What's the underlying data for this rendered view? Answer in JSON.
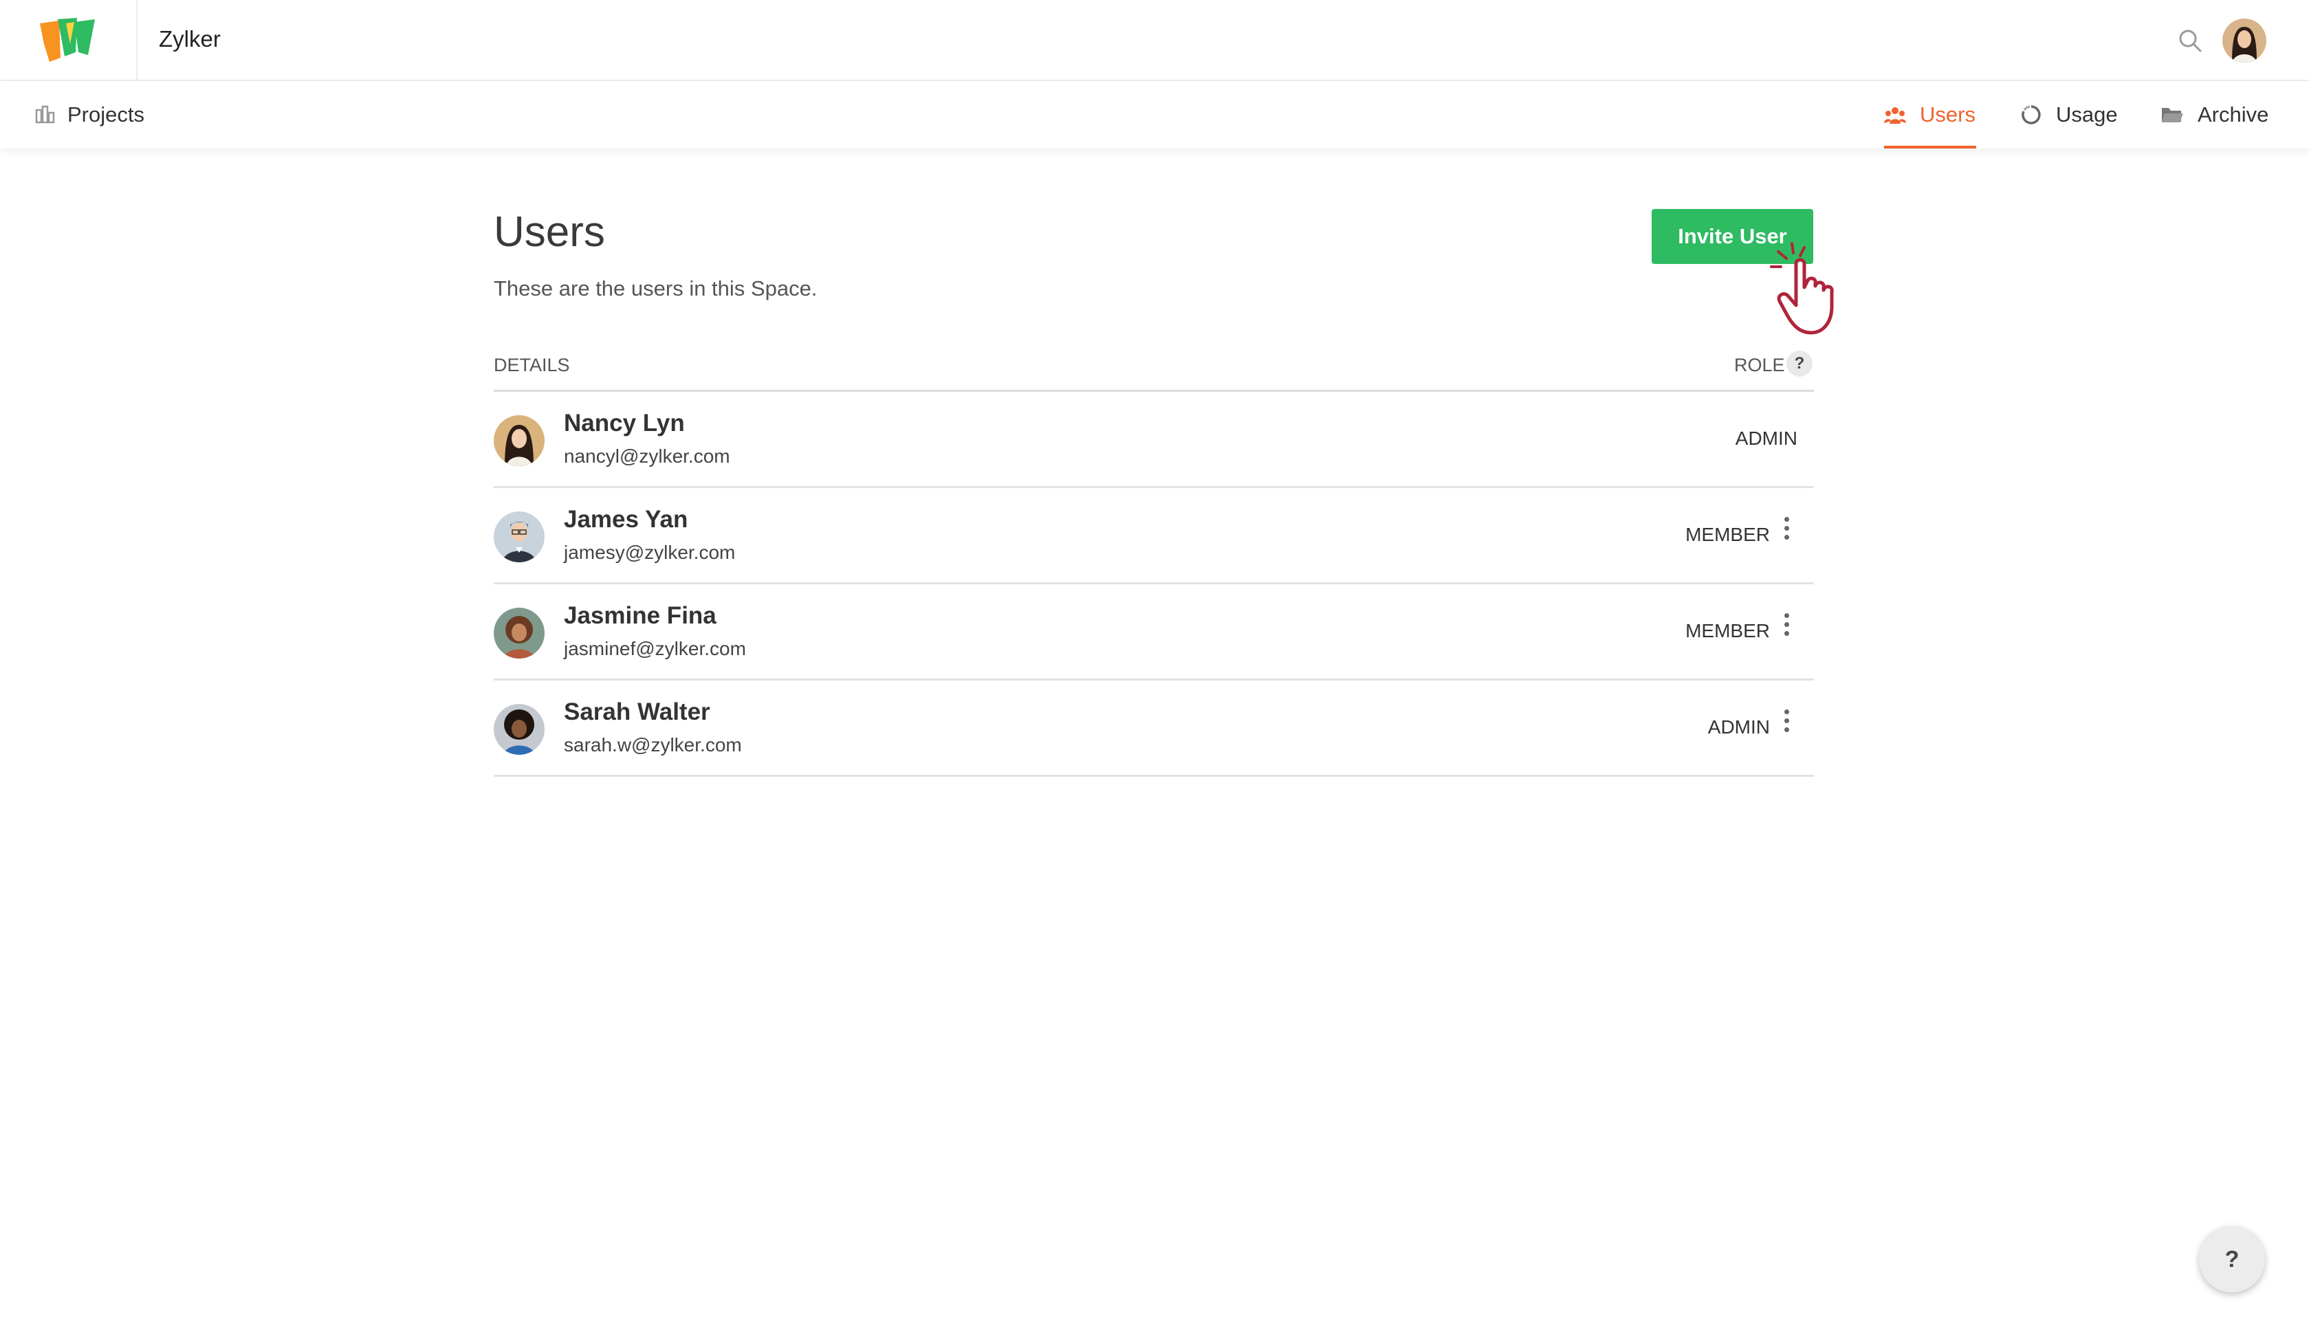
{
  "header": {
    "org_name": "Zylker"
  },
  "nav": {
    "projects_label": "Projects",
    "tabs": [
      {
        "label": "Users",
        "active": true
      },
      {
        "label": "Usage",
        "active": false
      },
      {
        "label": "Archive",
        "active": false
      }
    ]
  },
  "page": {
    "title": "Users",
    "description": "These are the users in this Space.",
    "invite_label": "Invite User"
  },
  "table": {
    "col_details": "DETAILS",
    "col_role": "ROLE",
    "role_help": "?",
    "users": [
      {
        "name": "Nancy Lyn",
        "email": "nancyl@zylker.com",
        "role": "ADMIN"
      },
      {
        "name": "James Yan",
        "email": "jamesy@zylker.com",
        "role": "MEMBER"
      },
      {
        "name": "Jasmine Fina",
        "email": "jasminef@zylker.com",
        "role": "MEMBER"
      },
      {
        "name": "Sarah Walter",
        "email": "sarah.w@zylker.com",
        "role": "ADMIN"
      }
    ]
  },
  "help_button": "?",
  "colors": {
    "accent": "#f0622e",
    "primary_button": "#2ebb62"
  },
  "icons": [
    "app-logo-icon",
    "search-icon",
    "projects-icon",
    "users-icon",
    "usage-icon",
    "archive-icon",
    "more-vertical-icon",
    "pointer-hand-icon"
  ]
}
